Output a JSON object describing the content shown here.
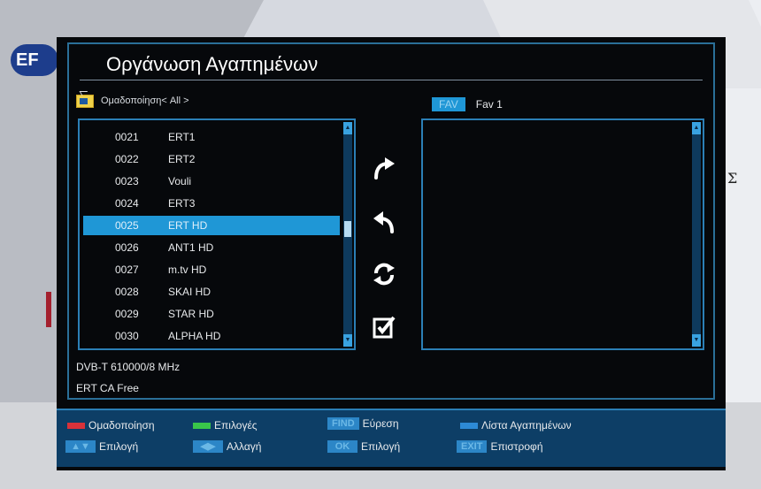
{
  "background": {
    "logo_text": "EF",
    "side_glyph": "Σ"
  },
  "window": {
    "title": "Οργάνωση Αγαπημένων"
  },
  "group": {
    "label": "Ομαδοποίηση< All >",
    "icon": "tv-icon"
  },
  "channels": [
    {
      "num": "0021",
      "name": "ERT1"
    },
    {
      "num": "0022",
      "name": "ERT2"
    },
    {
      "num": "0023",
      "name": "Vouli"
    },
    {
      "num": "0024",
      "name": "ERT3"
    },
    {
      "num": "0025",
      "name": "ERT HD"
    },
    {
      "num": "0026",
      "name": "ANT1 HD"
    },
    {
      "num": "0027",
      "name": "m.tv HD"
    },
    {
      "num": "0028",
      "name": "SKAI HD"
    },
    {
      "num": "0029",
      "name": "STAR HD"
    },
    {
      "num": "0030",
      "name": "ALPHA HD"
    }
  ],
  "selected_channel": "0025",
  "favorites": {
    "badge": "FAV",
    "label": "Fav 1"
  },
  "actions": [
    "redo-arrow-icon",
    "undo-arrow-icon",
    "swap-refresh-icon",
    "edit-check-icon"
  ],
  "info": {
    "line1": "DVB-T  610000/8 MHz",
    "line2": "ERT  CA Free"
  },
  "footer": {
    "red": "Ομαδοποίηση",
    "green": "Επιλογές",
    "find_key": "FIND",
    "find": "Εύρεση",
    "blue": "Λίστα Αγαπημένων",
    "updown_key": "▲▼",
    "updown": "Επιλογή",
    "leftright_key": "◀▶",
    "leftright": "Αλλαγή",
    "ok_key": "OK",
    "ok": "Επιλογή",
    "exit_key": "EXIT",
    "exit": "Επιστροφή"
  },
  "colors": {
    "accent": "#1f97d6",
    "border": "#2b7fb6",
    "footer_bg": "#0d3e66",
    "red_key": "#d8323a",
    "green_key": "#39c64a",
    "blue_key": "#2d8ad6"
  }
}
